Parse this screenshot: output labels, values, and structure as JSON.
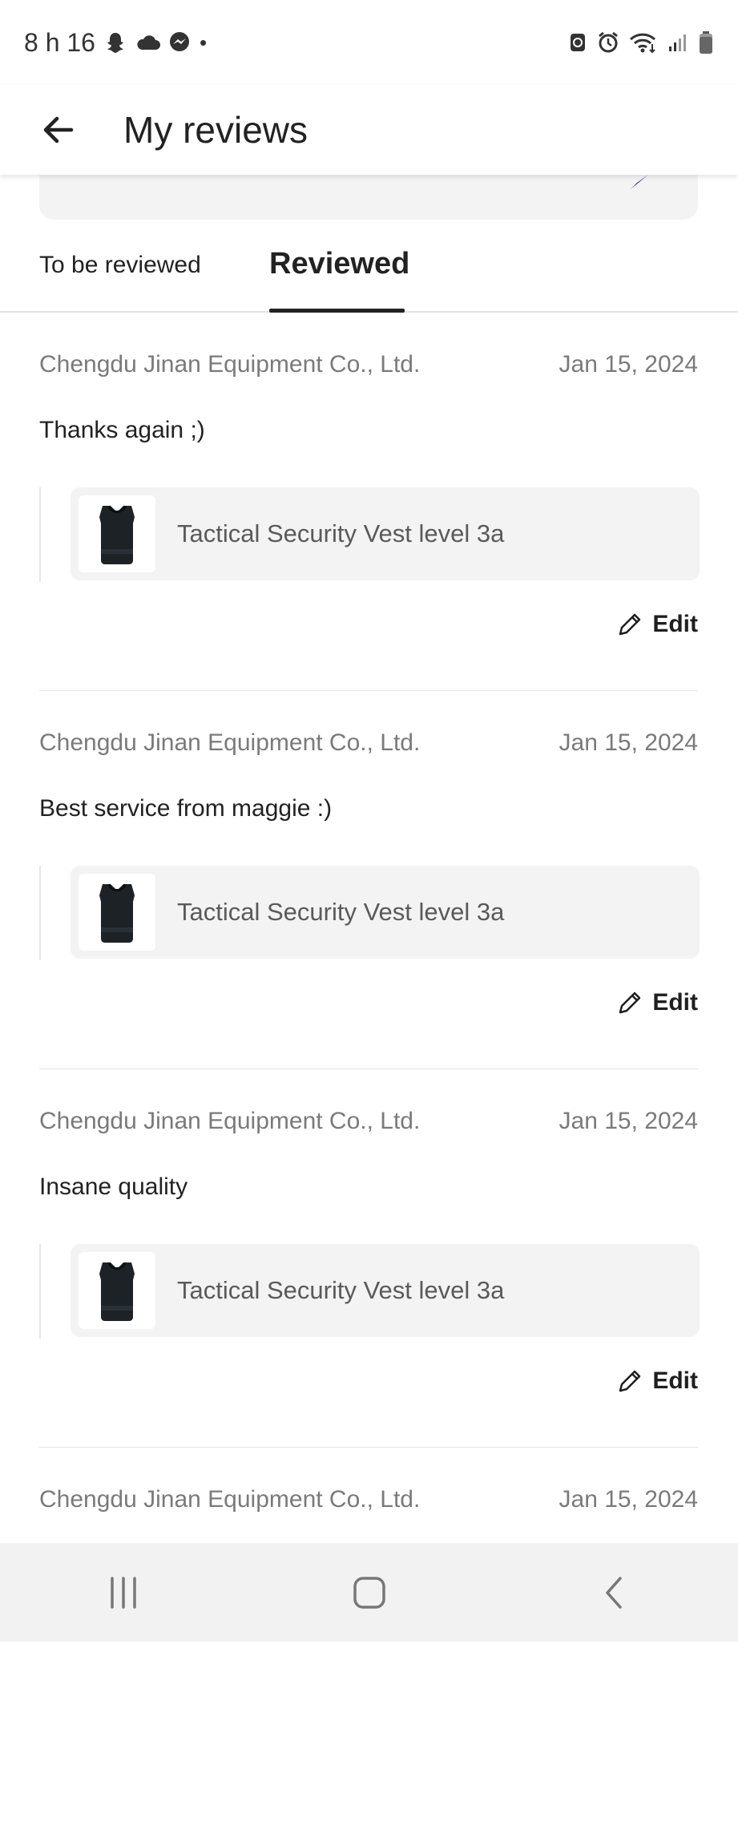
{
  "status_bar": {
    "time": "8 h 16",
    "dot": "•",
    "left_icons": [
      "snapchat-icon",
      "cloud-icon",
      "messenger-icon"
    ],
    "right_icons": [
      "battery-saver-icon",
      "alarm-icon",
      "wifi-icon",
      "signal-icon",
      "battery-icon"
    ]
  },
  "header": {
    "title": "My reviews",
    "back_icon": "arrow-left-icon"
  },
  "tabs": [
    {
      "label": "To be reviewed",
      "active": false
    },
    {
      "label": "Reviewed",
      "active": true
    }
  ],
  "reviews": [
    {
      "seller": "Chengdu Jinan Equipment Co., Ltd.",
      "date": "Jan 15, 2024",
      "text": "Thanks again ;)",
      "product": "Tactical Security Vest level 3a",
      "edit_label": "Edit"
    },
    {
      "seller": "Chengdu Jinan Equipment Co., Ltd.",
      "date": "Jan 15, 2024",
      "text": "Best service from maggie :)",
      "product": "Tactical Security Vest level 3a",
      "edit_label": "Edit"
    },
    {
      "seller": "Chengdu Jinan Equipment Co., Ltd.",
      "date": "Jan 15, 2024",
      "text": "Insane quality",
      "product": "Tactical Security Vest level 3a",
      "edit_label": "Edit"
    },
    {
      "seller": "Chengdu Jinan Equipment Co., Ltd.",
      "date": "Jan 15, 2024"
    }
  ],
  "colors": {
    "tab_active": "#222222",
    "card_bg": "#f3f3f3",
    "muted_text": "#7a7a7a",
    "banner_accent": "#2b2f8a"
  },
  "nav_bar": {
    "buttons": [
      "recent-apps-icon",
      "home-icon",
      "back-icon"
    ]
  }
}
